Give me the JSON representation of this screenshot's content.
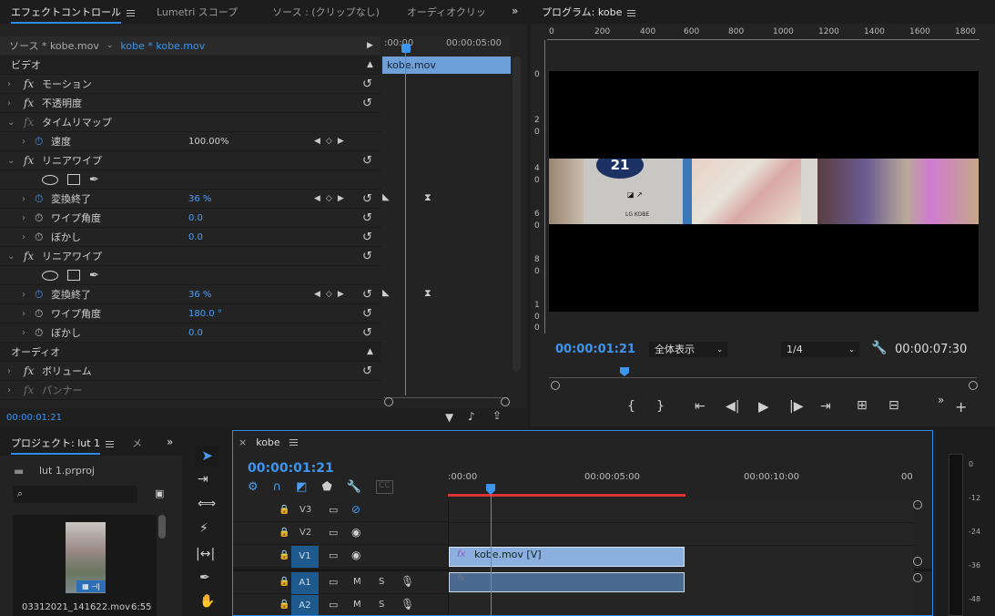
{
  "effect_controls": {
    "tabs": [
      "エフェクトコントロール",
      "Lumetri スコープ",
      "ソース : (クリップなし)",
      "オーディオクリッ"
    ],
    "source_label": "ソース * kobe.mov",
    "clip_label": "kobe * kobe.mov",
    "timeline_start": ":00:00",
    "timeline_end": "00:00:05:00",
    "clip_bar": "kobe.mov",
    "video_header": "ビデオ",
    "audio_header": "オーディオ",
    "rows": [
      {
        "label": "モーション"
      },
      {
        "label": "不透明度"
      },
      {
        "label": "タイムリマップ"
      },
      {
        "label": "速度",
        "value": "100.00%"
      },
      {
        "label": "リニアワイプ"
      },
      {
        "label": "変換終了",
        "value": "36 %"
      },
      {
        "label": "ワイプ角度",
        "value": "0.0"
      },
      {
        "label": "ぼかし",
        "value": "0.0"
      },
      {
        "label": "リニアワイプ"
      },
      {
        "label": "変換終了",
        "value": "36 %"
      },
      {
        "label": "ワイプ角度",
        "value": "180.0 °"
      },
      {
        "label": "ぼかし",
        "value": "0.0"
      },
      {
        "label": "ボリューム"
      },
      {
        "label": "パンナー"
      }
    ],
    "timecode": "00:00:01:21"
  },
  "program": {
    "title": "プログラム: kobe",
    "ruler": [
      "0",
      "200",
      "400",
      "600",
      "800",
      "1000",
      "1200",
      "1400",
      "1600",
      "1800"
    ],
    "vruler": [
      "0",
      "2",
      "0",
      "4",
      "0",
      "6",
      "0",
      "8",
      "0",
      "1 0",
      "0"
    ],
    "timecode": "00:00:01:21",
    "zoom": "全体表示",
    "resolution": "1/4",
    "duration": "00:00:07:30",
    "sign_number": "21",
    "sign_text": "LG KOBE"
  },
  "project": {
    "tab": "プロジェクト: lut 1",
    "tab2": "メ",
    "file": "lut 1.prproj",
    "clip_name": "03312021_141622.mov",
    "clip_duration": "6:55",
    "search_placeholder": ""
  },
  "timeline": {
    "tab": "kobe",
    "timecode": "00:00:01:21",
    "ruler": [
      ":00:00",
      "00:00:05:00",
      "00:00:10:00",
      "00"
    ],
    "tracks": [
      {
        "name": "V3",
        "icon": "eye-off"
      },
      {
        "name": "V2",
        "icon": "eye"
      },
      {
        "name": "V1",
        "icon": "eye"
      },
      {
        "name": "A1",
        "m": "M",
        "s": "S"
      },
      {
        "name": "A2",
        "m": "M",
        "s": "S"
      }
    ],
    "video_clip": "kobe.mov [V]",
    "meter": [
      "0",
      "-12",
      "-24",
      "-36",
      "-48"
    ]
  }
}
